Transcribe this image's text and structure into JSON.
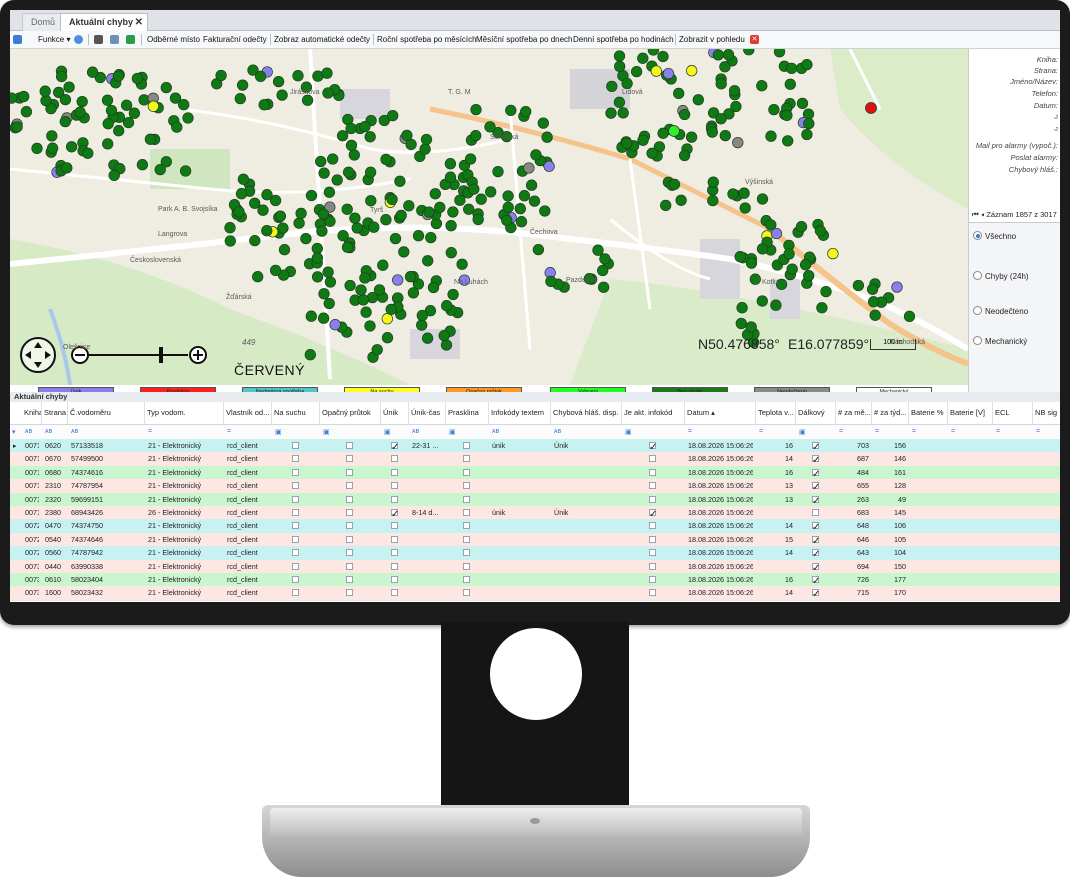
{
  "tabs": {
    "home": "Domů",
    "active": "Aktuální chyby",
    "close": "✕"
  },
  "toolbar": {
    "funkce": "Funkce",
    "items": [
      "Odběrné místo",
      "Fakturační odečty",
      "Zobraz automatické odečty",
      "Roční spotřeba po měsících",
      "Měsíční spotřeba po dnech",
      "Denní spotřeba po hodinách",
      "Zobrazit v pohledu"
    ]
  },
  "map": {
    "coord_n": "N50.476858°",
    "coord_e": "E16.077859°",
    "scale": "100 m",
    "cervenu": "ČERVENÝ",
    "number_449": "449",
    "streets": [
      "Park A. B. Svojsíka",
      "Langrova",
      "Československá",
      "Žďárská",
      "Na Luhách",
      "Pazderna",
      "Náchodská",
      "Výšinská",
      "U Kotlu",
      "Olešnice",
      "Tyrš",
      "T. G. M",
      "Lidová",
      "Sokolská",
      "Jiráskova",
      "Čechova"
    ]
  },
  "legend": [
    {
      "label": "Únik",
      "color": "#8a7fe8"
    },
    {
      "label": "Prasklina",
      "color": "#ff1f1f"
    },
    {
      "label": "Nadměrná spotřeba",
      "color": "#4fc7c7"
    },
    {
      "label": "Na suchu",
      "color": "#ffff22"
    },
    {
      "label": "Opačný průtok",
      "color": "#ff9922"
    },
    {
      "label": "Vybraný",
      "color": "#22ff22"
    },
    {
      "label": "Bez chyby",
      "color": "#1a7a1a"
    },
    {
      "label": "Neodečteno",
      "color": "#8a8a8a"
    },
    {
      "label": "Mechanický",
      "color": "#ffffff"
    }
  ],
  "rightpanel": {
    "labels": [
      "Kniha:",
      "Strana:",
      "Jméno/Název:",
      "Telefon:",
      "Datum:",
      "-2",
      "-2",
      "Mail pro alarmy (vypoč.):",
      "Poslat alarmy:",
      "Chybový hláš.:"
    ],
    "nav": "Záznam 1857 z 3017",
    "radios": [
      "Všechno",
      "Chyby (24h)",
      "Neodečteno",
      "Mechanický"
    ]
  },
  "grid": {
    "title": "Aktuální chyby",
    "columns": [
      "Kniha",
      "Strana",
      "Č.vodoměru",
      "Typ vodom.",
      "Vlastník od...",
      "Na suchu",
      "Opačný průtok",
      "Únik",
      "Únik-čas",
      "Prasklina",
      "Infokódy textem",
      "Chybová hláš. disp.",
      "Je akt. infokód",
      "Datum",
      "Teplota v...",
      "Dálkový",
      "# za mě...",
      "# za týd...",
      "Baterie %",
      "Baterie [V]",
      "ECL",
      "NB sig"
    ],
    "rows": [
      {
        "kniha": "0071",
        "strana": "0620",
        "vod": "57133518",
        "typ": "21 - Elektronický",
        "vlast": "rcd_client",
        "unik": true,
        "unikcas": "22-31 ...",
        "info": "únik",
        "chyb": "Únik",
        "akt": true,
        "datum": "18.08.2026 15:06:26",
        "tepl": "16",
        "dalk": true,
        "mes": "703",
        "tyd": "156",
        "c": "#c8f2f2"
      },
      {
        "kniha": "0071",
        "strana": "0670",
        "vod": "57499500",
        "typ": "21 - Elektronický",
        "vlast": "rcd_client",
        "unik": false,
        "unikcas": "",
        "info": "",
        "chyb": "",
        "akt": false,
        "datum": "18.08.2026 15:06:26",
        "tepl": "14",
        "dalk": true,
        "mes": "687",
        "tyd": "146",
        "c": "#fde7e3"
      },
      {
        "kniha": "0071",
        "strana": "0680",
        "vod": "74374616",
        "typ": "21 - Elektronický",
        "vlast": "rcd_client",
        "unik": false,
        "unikcas": "",
        "info": "",
        "chyb": "",
        "akt": false,
        "datum": "18.08.2026 15:06:26",
        "tepl": "16",
        "dalk": true,
        "mes": "484",
        "tyd": "161",
        "c": "#c9f5cf"
      },
      {
        "kniha": "0071",
        "strana": "2310",
        "vod": "74787954",
        "typ": "21 - Elektronický",
        "vlast": "rcd_client",
        "unik": false,
        "unikcas": "",
        "info": "",
        "chyb": "",
        "akt": false,
        "datum": "18.08.2026 15:06:26",
        "tepl": "13",
        "dalk": true,
        "mes": "655",
        "tyd": "128",
        "c": "#fde7e3"
      },
      {
        "kniha": "0071",
        "strana": "2320",
        "vod": "59699151",
        "typ": "21 - Elektronický",
        "vlast": "rcd_client",
        "unik": false,
        "unikcas": "",
        "info": "",
        "chyb": "",
        "akt": false,
        "datum": "18.08.2026 15:06:26",
        "tepl": "13",
        "dalk": true,
        "mes": "263",
        "tyd": "49",
        "c": "#c9f5cf"
      },
      {
        "kniha": "0071",
        "strana": "2380",
        "vod": "68943426",
        "typ": "26 - Elektronický",
        "vlast": "rcd_client",
        "unik": true,
        "unikcas": "8-14 d...",
        "info": "únik",
        "chyb": "Únik",
        "akt": true,
        "datum": "18.08.2026 15:06:26",
        "tepl": "",
        "dalk": false,
        "mes": "683",
        "tyd": "145",
        "c": "#fde7e3"
      },
      {
        "kniha": "0072",
        "strana": "0470",
        "vod": "74374750",
        "typ": "21 - Elektronický",
        "vlast": "rcd_client",
        "unik": false,
        "unikcas": "",
        "info": "",
        "chyb": "",
        "akt": false,
        "datum": "18.08.2026 15:06:26",
        "tepl": "14",
        "dalk": true,
        "mes": "648",
        "tyd": "106",
        "c": "#c8f2f2"
      },
      {
        "kniha": "0072",
        "strana": "0540",
        "vod": "74374646",
        "typ": "21 - Elektronický",
        "vlast": "rcd_client",
        "unik": false,
        "unikcas": "",
        "info": "",
        "chyb": "",
        "akt": false,
        "datum": "18.08.2026 15:06:26",
        "tepl": "15",
        "dalk": true,
        "mes": "646",
        "tyd": "105",
        "c": "#fde7e3"
      },
      {
        "kniha": "0072",
        "strana": "0560",
        "vod": "74787942",
        "typ": "21 - Elektronický",
        "vlast": "rcd_client",
        "unik": false,
        "unikcas": "",
        "info": "",
        "chyb": "",
        "akt": false,
        "datum": "18.08.2026 15:06:26",
        "tepl": "14",
        "dalk": true,
        "mes": "643",
        "tyd": "104",
        "c": "#c8f2f2"
      },
      {
        "kniha": "0073",
        "strana": "0440",
        "vod": "63990338",
        "typ": "21 - Elektronický",
        "vlast": "rcd_client",
        "unik": false,
        "unikcas": "",
        "info": "",
        "chyb": "",
        "akt": false,
        "datum": "18.08.2026 15:06:26",
        "tepl": "",
        "dalk": true,
        "mes": "694",
        "tyd": "150",
        "c": "#fde7e3"
      },
      {
        "kniha": "0073",
        "strana": "0610",
        "vod": "58023404",
        "typ": "21 - Elektronický",
        "vlast": "rcd_client",
        "unik": false,
        "unikcas": "",
        "info": "",
        "chyb": "",
        "akt": false,
        "datum": "18.08.2026 15:06:26",
        "tepl": "16",
        "dalk": true,
        "mes": "726",
        "tyd": "177",
        "c": "#c9f5cf"
      },
      {
        "kniha": "0073",
        "strana": "1600",
        "vod": "58023432",
        "typ": "21 - Elektronický",
        "vlast": "rcd_client",
        "unik": false,
        "unikcas": "",
        "info": "",
        "chyb": "",
        "akt": false,
        "datum": "18.08.2026 15:06:26",
        "tepl": "14",
        "dalk": true,
        "mes": "715",
        "tyd": "170",
        "c": "#fde7e3"
      }
    ]
  }
}
